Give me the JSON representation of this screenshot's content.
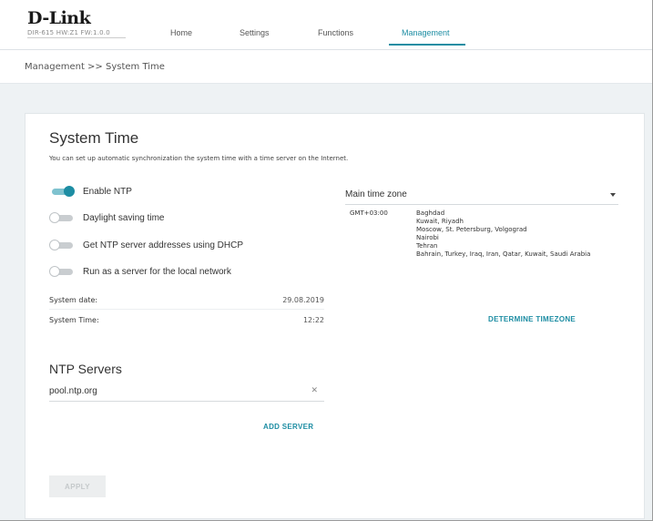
{
  "header": {
    "brand": "D-Link",
    "hw_info": "DIR-615 HW:Z1 FW:1.0.0",
    "nav": [
      "Home",
      "Settings",
      "Functions",
      "Management"
    ],
    "active_nav": "Management"
  },
  "breadcrumb": "Management >> System Time",
  "card": {
    "title": "System Time",
    "description": "You can set up automatic synchronization the system time with a time server on the Internet.",
    "toggles": [
      {
        "label": "Enable NTP",
        "on": true
      },
      {
        "label": "Daylight saving time",
        "on": false
      },
      {
        "label": "Get NTP server addresses using DHCP",
        "on": false
      },
      {
        "label": "Run as a server for the local network",
        "on": false
      }
    ],
    "system_date": {
      "label": "System date:",
      "value": "29.08.2019"
    },
    "system_time": {
      "label": "System Time:",
      "value": "12:22"
    },
    "ntp_section_title": "NTP Servers",
    "ntp_server": "pool.ntp.org",
    "add_server_label": "ADD SERVER",
    "apply_label": "APPLY",
    "timezone": {
      "select_label": "Main time zone",
      "offset": "GMT+03:00",
      "cities": [
        "Baghdad",
        "Kuwait, Riyadh",
        "Moscow, St. Petersburg, Volgograd",
        "Nairobi",
        "Tehran",
        "Bahrain, Turkey, Iraq, Iran, Qatar, Kuwait, Saudi Arabia"
      ],
      "determine_label": "DETERMINE TIMEZONE"
    }
  },
  "colors": {
    "accent": "#1d8da3",
    "content_background": "#eef2f4"
  },
  "icons": {
    "clear": "close-icon",
    "dropdown": "caret-down-icon"
  }
}
